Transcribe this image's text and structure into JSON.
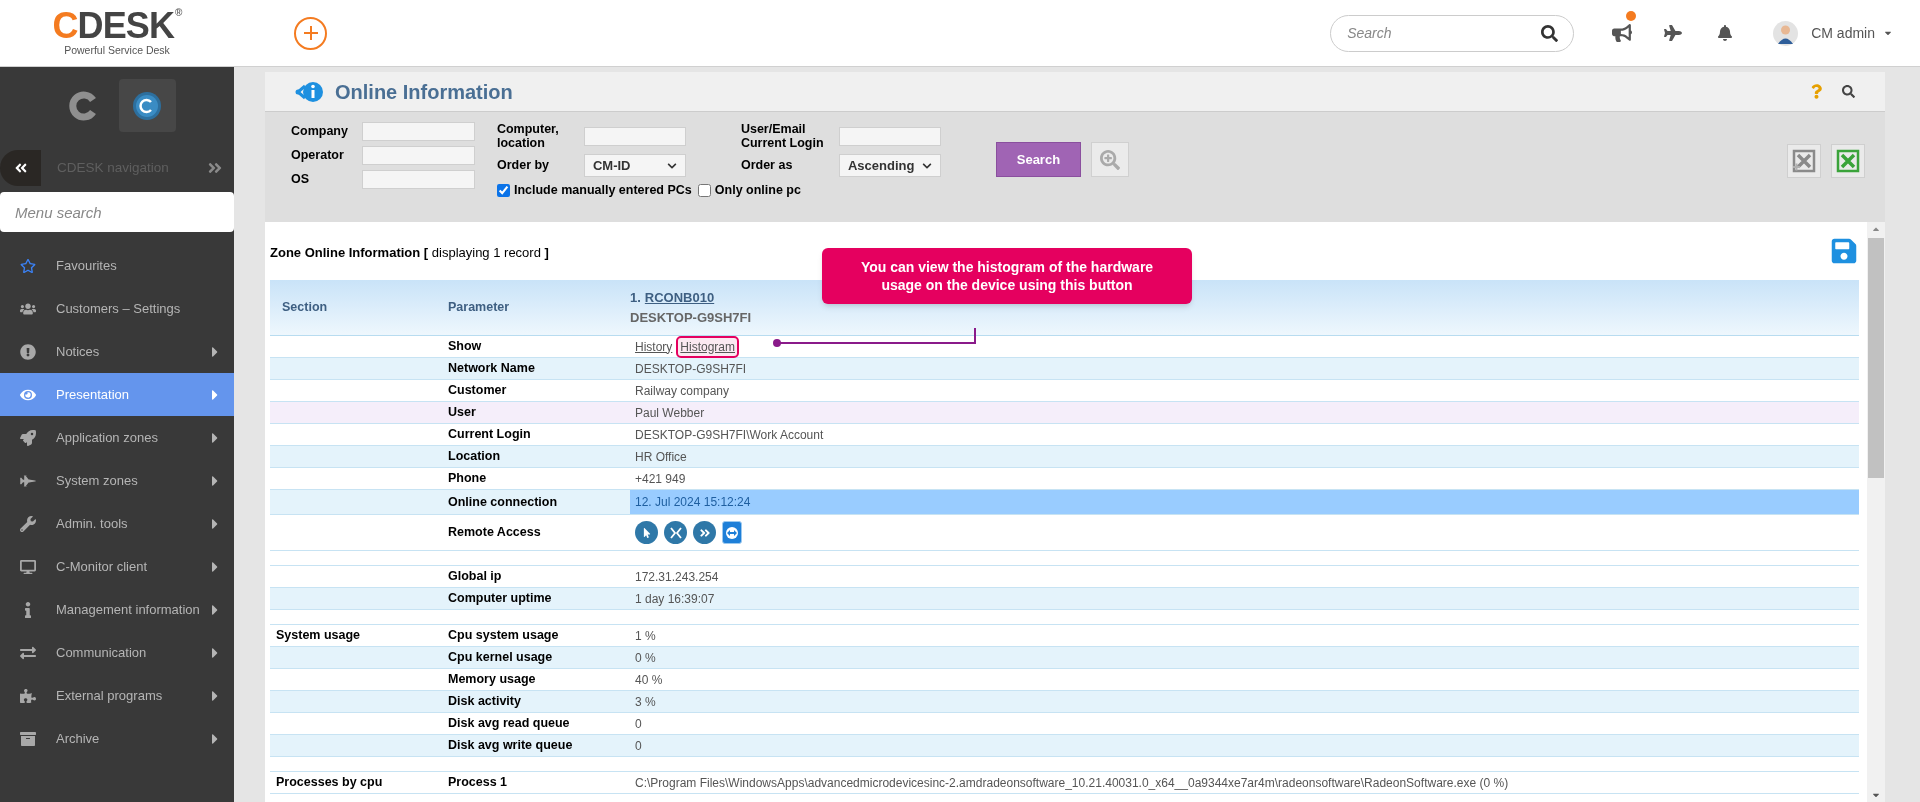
{
  "header": {
    "logo": {
      "name": "CDESK",
      "tagline": "Powerful Service Desk",
      "mark": "®"
    },
    "search": {
      "placeholder": "Search"
    },
    "notification_dot": true,
    "user": "CM admin"
  },
  "sidebar": {
    "navigation_label": "CDESK navigation",
    "search": {
      "placeholder": "Menu search"
    },
    "items": [
      {
        "label": "Favourites",
        "selected": false,
        "submenu": false
      },
      {
        "label": "Customers – Settings",
        "selected": false,
        "submenu": false
      },
      {
        "label": "Notices",
        "selected": false,
        "submenu": true
      },
      {
        "label": "Presentation",
        "selected": true,
        "submenu": true
      },
      {
        "label": "Application zones",
        "selected": false,
        "submenu": true
      },
      {
        "label": "System zones",
        "selected": false,
        "submenu": true
      },
      {
        "label": "Admin. tools",
        "selected": false,
        "submenu": true
      },
      {
        "label": "C-Monitor client",
        "selected": false,
        "submenu": true
      },
      {
        "label": "Management information",
        "selected": false,
        "submenu": true
      },
      {
        "label": "Communication",
        "selected": false,
        "submenu": true
      },
      {
        "label": "External programs",
        "selected": false,
        "submenu": true
      },
      {
        "label": "Archive",
        "selected": false,
        "submenu": true
      }
    ]
  },
  "page": {
    "title": "Online Information",
    "filters": {
      "company": {
        "label": "Company"
      },
      "operator": {
        "label": "Operator"
      },
      "os": {
        "label": "OS"
      },
      "computer": {
        "label": "Computer, location"
      },
      "order_by": {
        "label": "Order by",
        "value": "CM-ID"
      },
      "include_manual": {
        "label": "Include manually entered PCs",
        "checked": true
      },
      "user": {
        "label": "User/Email Current Login"
      },
      "order_as": {
        "label": "Order as",
        "value": "Ascending"
      },
      "only_online": {
        "label": "Only online pc",
        "checked": false
      },
      "search_button": "Search"
    },
    "table": {
      "title": "**Zone Online Information [** displaying 1 record **]**",
      "columns": [
        "Section",
        "Parameter"
      ],
      "record": {
        "id": "RCONB010",
        "number": "1.",
        "name": "DESKTOP-G9SH7FI"
      },
      "rows": [
        {
          "kind": "links",
          "section": "",
          "parameter": "Show",
          "links": [
            {
              "label": "History",
              "highlighted": false
            },
            {
              "label": "Histogram",
              "highlighted": true
            }
          ]
        },
        {
          "kind": "text",
          "section": "",
          "parameter": "Network Name",
          "value": "DESKTOP-G9SH7FI",
          "hovered": false,
          "selected": false
        },
        {
          "kind": "text",
          "section": "",
          "parameter": "Customer",
          "value": "Railway company",
          "hovered": false,
          "selected": false
        },
        {
          "kind": "text",
          "section": "",
          "parameter": "User",
          "value": "Paul Webber",
          "hovered": true,
          "selected": false
        },
        {
          "kind": "text",
          "section": "",
          "parameter": "Current Login",
          "value": "DESKTOP-G9SH7FI\\Work Account",
          "hovered": false,
          "selected": false
        },
        {
          "kind": "text",
          "section": "",
          "parameter": "Location",
          "value": "HR Office",
          "hovered": false,
          "selected": false
        },
        {
          "kind": "text",
          "section": "",
          "parameter": "Phone",
          "value": "+421 949",
          "hovered": false,
          "selected": false
        },
        {
          "kind": "text",
          "section": "",
          "parameter": "Online connection",
          "value": "12. Jul 2024 15:12:24",
          "hovered": false,
          "selected": true
        },
        {
          "kind": "remote",
          "section": "",
          "parameter": "Remote Access"
        },
        {
          "kind": "spacer"
        },
        {
          "kind": "text",
          "section": "",
          "parameter": "Global ip",
          "value": "172.31.243.254",
          "hovered": false,
          "selected": false
        },
        {
          "kind": "text",
          "section": "",
          "parameter": "Computer uptime",
          "value": "1 day 16:39:07",
          "hovered": false,
          "selected": false
        },
        {
          "kind": "spacer"
        },
        {
          "kind": "text",
          "section": "System usage",
          "parameter": "Cpu system usage",
          "value": "1 %",
          "hovered": false,
          "selected": false
        },
        {
          "kind": "text",
          "section": "",
          "parameter": "Cpu kernel usage",
          "value": "0 %",
          "hovered": false,
          "selected": false
        },
        {
          "kind": "text",
          "section": "",
          "parameter": "Memory usage",
          "value": "40 %",
          "hovered": false,
          "selected": false
        },
        {
          "kind": "text",
          "section": "",
          "parameter": "Disk activity",
          "value": "3 %",
          "hovered": false,
          "selected": false
        },
        {
          "kind": "text",
          "section": "",
          "parameter": "Disk avg read queue",
          "value": "0",
          "hovered": false,
          "selected": false
        },
        {
          "kind": "text",
          "section": "",
          "parameter": "Disk avg write queue",
          "value": "0",
          "hovered": false,
          "selected": false
        },
        {
          "kind": "spacer"
        },
        {
          "kind": "text",
          "section": "Processes by cpu",
          "parameter": "Process 1",
          "value": "C:\\Program Files\\WindowsApps\\advancedmicrodevicesinc-2.amdradeonsoftware_10.21.40031.0_x64__0a9344xe7ar4m\\radeonsoftware\\RadeonSoftware.exe (0 %)",
          "hovered": false,
          "selected": false
        }
      ]
    },
    "callout": "You can view the histogram of the hardware usage on the device using this button"
  }
}
